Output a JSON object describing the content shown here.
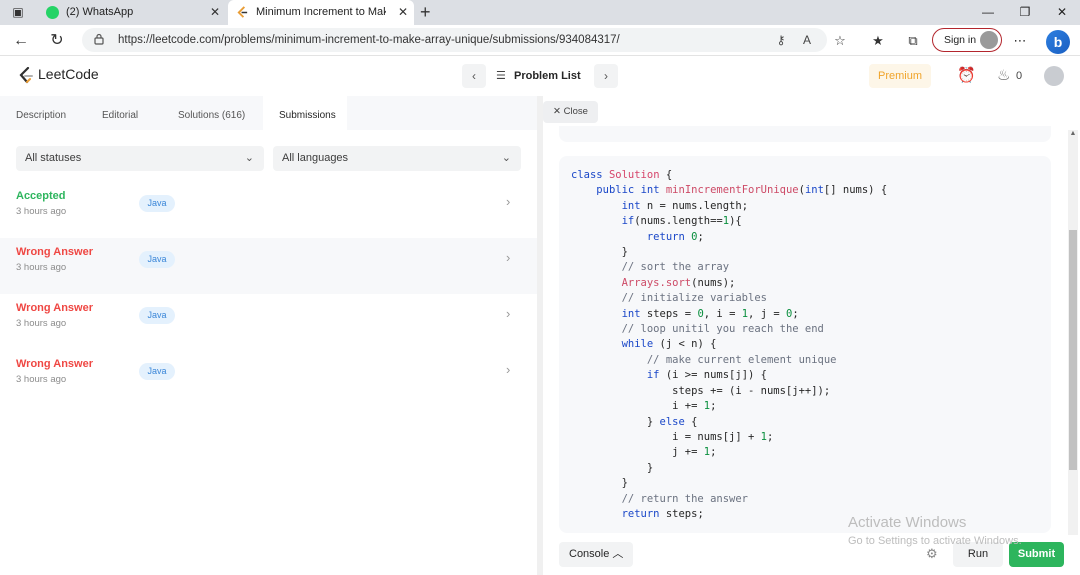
{
  "browser": {
    "tabs": [
      {
        "title": "(2) WhatsApp"
      },
      {
        "title": "Minimum Increment to Make Array Unique"
      }
    ],
    "url": "https://leetcode.com/problems/minimum-increment-to-make-array-unique/submissions/934084317/",
    "sign_in_label": "Sign in"
  },
  "header": {
    "brand": "LeetCode",
    "problem_list_label": "Problem List",
    "premium_label": "Premium",
    "streak_count": "0"
  },
  "left_panel": {
    "tabs": [
      "Description",
      "Editorial",
      "Solutions (616)",
      "Submissions"
    ],
    "filters": {
      "status": "All statuses",
      "language": "All languages"
    },
    "submissions": [
      {
        "status": "Accepted",
        "time": "3 hours ago",
        "language": "Java"
      },
      {
        "status": "Wrong Answer",
        "time": "3 hours ago",
        "language": "Java"
      },
      {
        "status": "Wrong Answer",
        "time": "3 hours ago",
        "language": "Java"
      },
      {
        "status": "Wrong Answer",
        "time": "3 hours ago",
        "language": "Java"
      }
    ]
  },
  "right_panel": {
    "close_label": "Close",
    "code_lines": [
      "class Solution {",
      "    public int minIncrementForUnique(int[] nums) {",
      "        int n = nums.length;",
      "        if(nums.length==1){",
      "            return 0;",
      "        }",
      "        // sort the array",
      "        Arrays.sort(nums);",
      "        // initialize variables",
      "        int steps = 0, i = 1, j = 0;",
      "        // loop unitil you reach the end",
      "        while (j < n) {",
      "            // make current element unique",
      "            if (i >= nums[j]) {",
      "                steps += (i - nums[j++]);",
      "                i += 1;",
      "            } else {",
      "                i = nums[j] + 1;",
      "                j += 1;",
      "            }",
      "        }",
      "        // return the answer",
      "        return steps;"
    ],
    "console_label": "Console",
    "run_label": "Run",
    "submit_label": "Submit"
  },
  "watermark": {
    "line1": "Activate Windows",
    "line2": "Go to Settings to activate Windows."
  },
  "colors": {
    "accepted": "#2db55d",
    "wrong": "#ef4743",
    "submit": "#2db55d",
    "premium": "#f0a42a"
  }
}
